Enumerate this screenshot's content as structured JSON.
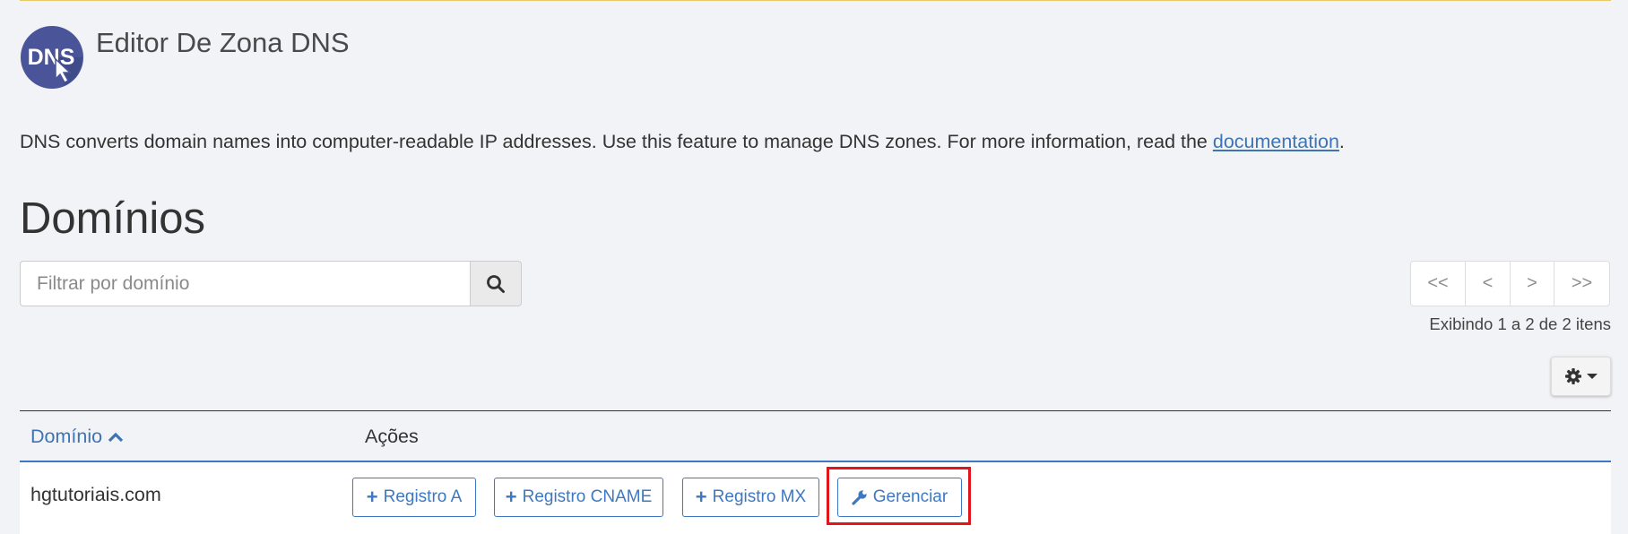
{
  "app": {
    "title": "Editor De Zona DNS",
    "logo_text": "DNS",
    "description": "DNS converts domain names into computer-readable IP addresses. Use this feature to manage DNS zones. For more information, read the ",
    "description_link": "documentation",
    "description_end": "."
  },
  "section": {
    "title": "Domínios"
  },
  "search": {
    "placeholder": "Filtrar por domínio",
    "value": ""
  },
  "pagination": {
    "first": "<<",
    "prev": "<",
    "next": ">",
    "last": ">>",
    "info": "Exibindo 1 a 2 de 2 itens"
  },
  "table": {
    "columns": [
      "Domínio",
      "Ações"
    ],
    "sort": "ascending",
    "rows": [
      {
        "domain": "hgtutoriais.com",
        "actions": [
          "Registro A",
          "Registro CNAME",
          "Registro MX",
          "Gerenciar"
        ]
      }
    ]
  },
  "colors": {
    "accent": "#3d78c1",
    "background": "#f2f3f6",
    "highlight": "#e0161b",
    "logo_bg": "#4a5599"
  }
}
